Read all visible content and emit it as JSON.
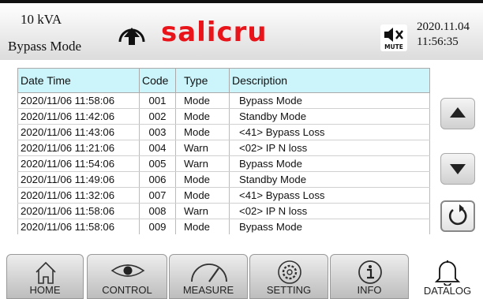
{
  "header": {
    "model": "10 kVA",
    "mode": "Bypass Mode",
    "brand": "salicru",
    "mute_label": "MUTE",
    "date": "2020.11.04",
    "time": "11:56:35",
    "brand_color": "#e8141a"
  },
  "log_table": {
    "columns": [
      "Date Time",
      "Code",
      "Type",
      "Description"
    ],
    "rows": [
      {
        "datetime": "2020/11/06 11:58:06",
        "code": "001",
        "type": "Mode",
        "description": "Bypass Mode"
      },
      {
        "datetime": "2020/11/06 11:42:06",
        "code": "002",
        "type": "Mode",
        "description": "Standby Mode"
      },
      {
        "datetime": "2020/11/06 11:43:06",
        "code": "003",
        "type": "Mode",
        "description": "<41> Bypass Loss"
      },
      {
        "datetime": "2020/11/06 11:21:06",
        "code": "004",
        "type": "Warn",
        "description": "<02> IP N loss"
      },
      {
        "datetime": "2020/11/06 11:54:06",
        "code": "005",
        "type": "Warn",
        "description": "Bypass Mode"
      },
      {
        "datetime": "2020/11/06 11:49:06",
        "code": "006",
        "type": "Mode",
        "description": "Standby Mode"
      },
      {
        "datetime": "2020/11/06 11:32:06",
        "code": "007",
        "type": "Mode",
        "description": "<41> Bypass Loss"
      },
      {
        "datetime": "2020/11/06 11:58:06",
        "code": "008",
        "type": "Warn",
        "description": "<02> IP N loss"
      },
      {
        "datetime": "2020/11/06 11:58:06",
        "code": "009",
        "type": "Mode",
        "description": "Bypass Mode"
      }
    ]
  },
  "side_buttons": {
    "up_icon": "arrow-up-icon",
    "down_icon": "arrow-down-icon",
    "refresh_icon": "refresh-icon"
  },
  "nav": {
    "tabs": [
      {
        "label": "HOME",
        "icon": "home-icon"
      },
      {
        "label": "CONTROL",
        "icon": "eye-icon"
      },
      {
        "label": "MEASURE",
        "icon": "gauge-icon"
      },
      {
        "label": "SETTING",
        "icon": "gear-icon"
      },
      {
        "label": "INFO",
        "icon": "info-icon"
      },
      {
        "label": "DATALOG",
        "icon": "bell-icon",
        "active": true
      }
    ]
  }
}
